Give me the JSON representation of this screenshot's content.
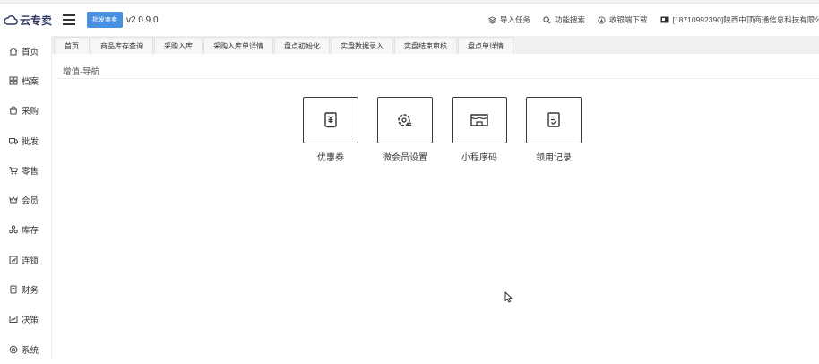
{
  "app": {
    "brand": "云专卖",
    "badge": "批发商卖",
    "version": "v2.0.9.0"
  },
  "header": {
    "links": [
      {
        "label": "导入任务",
        "icon": "import-task-icon"
      },
      {
        "label": "功能搜索",
        "icon": "search-icon"
      },
      {
        "label": "收银端下载",
        "icon": "download-icon"
      }
    ],
    "user": "[18710992390]陕西中顶商通信息科技有限公"
  },
  "sidebar": {
    "items": [
      {
        "label": "首页",
        "icon": "home-icon"
      },
      {
        "label": "档案",
        "icon": "archive-icon"
      },
      {
        "label": "采购",
        "icon": "purchase-icon"
      },
      {
        "label": "批发",
        "icon": "wholesale-icon"
      },
      {
        "label": "零售",
        "icon": "retail-cart-icon"
      },
      {
        "label": "会员",
        "icon": "member-icon"
      },
      {
        "label": "库存",
        "icon": "inventory-icon"
      },
      {
        "label": "连锁",
        "icon": "chain-icon"
      },
      {
        "label": "财务",
        "icon": "finance-icon"
      },
      {
        "label": "决策",
        "icon": "decision-icon"
      },
      {
        "label": "系统",
        "icon": "system-icon"
      }
    ]
  },
  "tabs": [
    "首页",
    "商品库存查询",
    "采购入库",
    "采购入库单详情",
    "盘点初始化",
    "实盘数据录入",
    "实盘结束审核",
    "盘点单详情"
  ],
  "breadcrumb": "增值-导航",
  "tiles": [
    {
      "label": "优惠券",
      "icon": "coupon-icon"
    },
    {
      "label": "微会员设置",
      "icon": "member-settings-icon"
    },
    {
      "label": "小程序码",
      "icon": "mini-program-icon"
    },
    {
      "label": "领用记录",
      "icon": "record-icon"
    }
  ],
  "colors": {
    "brand": "#2d3560",
    "badge": "#4a90e2",
    "tab_bar": "#f0f0f0"
  }
}
